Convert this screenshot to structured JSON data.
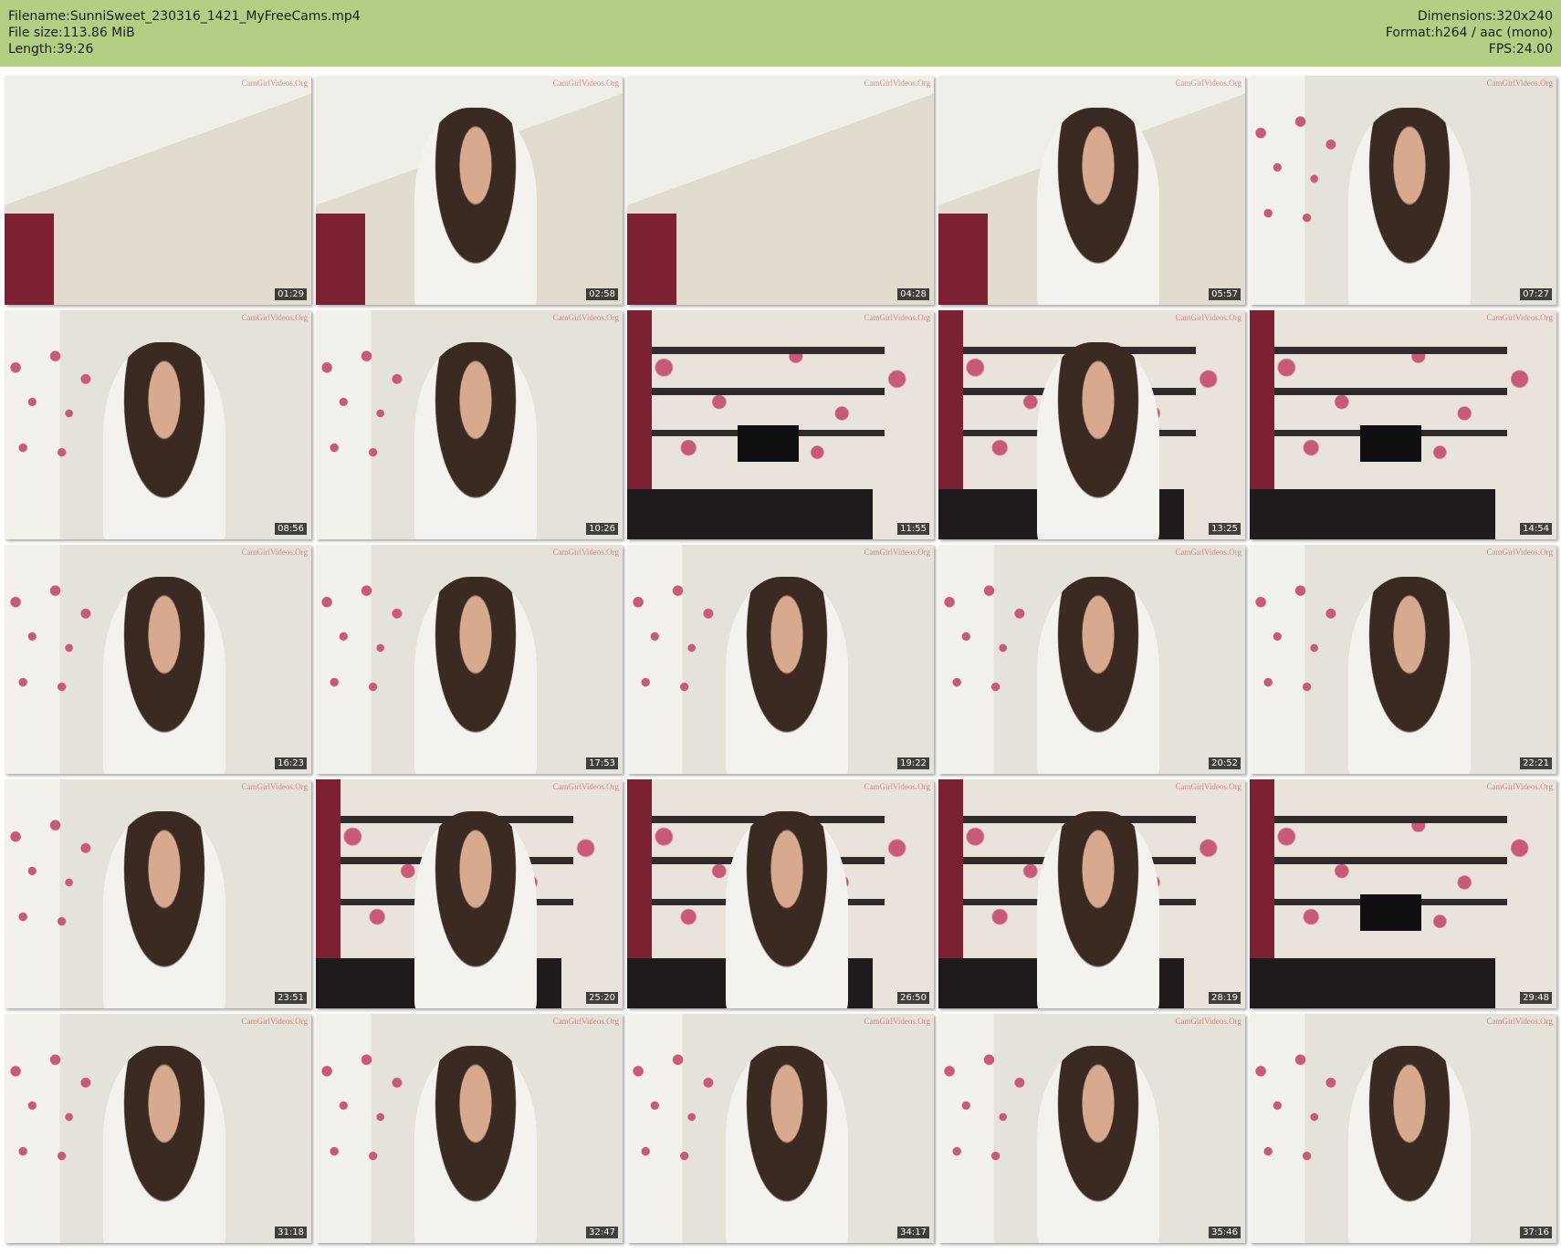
{
  "header": {
    "background": "#b3cf84",
    "left": [
      {
        "label": "Filename:",
        "value": "SunniSweet_230316_1421_MyFreeCams.mp4"
      },
      {
        "label": "File size:",
        "value": "113.86 MiB"
      },
      {
        "label": "Length:",
        "value": "39:26"
      }
    ],
    "right": [
      {
        "label": "Dimensions:",
        "value": "320x240"
      },
      {
        "label": "Format:",
        "value": "h264 / aac (mono)"
      },
      {
        "label": "FPS:",
        "value": "24.00"
      }
    ]
  },
  "watermark": "CamGirlVideos.Org",
  "thumbnails": [
    {
      "time": "01:29",
      "scene": "ceiling"
    },
    {
      "time": "02:58",
      "scene": "person-ceiling"
    },
    {
      "time": "04:28",
      "scene": "ceiling"
    },
    {
      "time": "05:57",
      "scene": "person-ceiling"
    },
    {
      "time": "07:27",
      "scene": "person-flowers"
    },
    {
      "time": "08:56",
      "scene": "person-flowers"
    },
    {
      "time": "10:26",
      "scene": "person-flowers"
    },
    {
      "time": "11:55",
      "scene": "room"
    },
    {
      "time": "13:25",
      "scene": "person-room"
    },
    {
      "time": "14:54",
      "scene": "room"
    },
    {
      "time": "16:23",
      "scene": "person-flowers"
    },
    {
      "time": "17:53",
      "scene": "person-flowers"
    },
    {
      "time": "19:22",
      "scene": "person-flowers"
    },
    {
      "time": "20:52",
      "scene": "person-flowers"
    },
    {
      "time": "22:21",
      "scene": "person-flowers"
    },
    {
      "time": "23:51",
      "scene": "person-flowers"
    },
    {
      "time": "25:20",
      "scene": "person-room"
    },
    {
      "time": "26:50",
      "scene": "person-room"
    },
    {
      "time": "28:19",
      "scene": "person-room"
    },
    {
      "time": "29:48",
      "scene": "room"
    },
    {
      "time": "31:18",
      "scene": "person-flowers"
    },
    {
      "time": "32:47",
      "scene": "person-flowers"
    },
    {
      "time": "34:17",
      "scene": "person-flowers"
    },
    {
      "time": "35:46",
      "scene": "person-flowers"
    },
    {
      "time": "37:16",
      "scene": "person-flowers"
    }
  ]
}
